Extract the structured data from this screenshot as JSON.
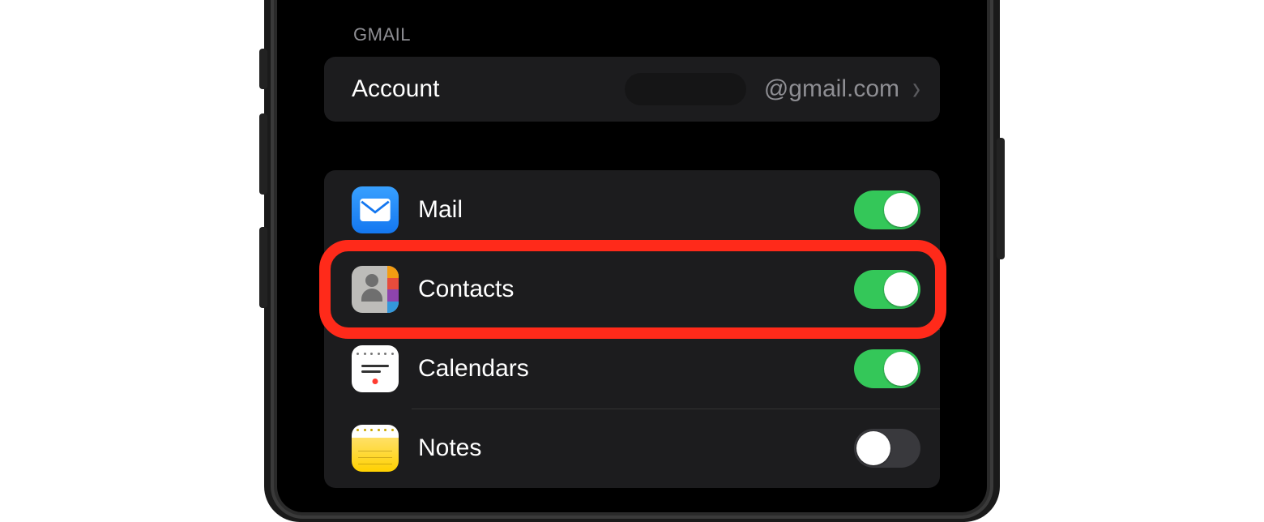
{
  "section_header": "GMAIL",
  "account_row": {
    "label": "Account",
    "value": "@gmail.com"
  },
  "services": [
    {
      "key": "mail",
      "label": "Mail",
      "icon": "mail-icon",
      "on": true
    },
    {
      "key": "contacts",
      "label": "Contacts",
      "icon": "contacts-icon",
      "on": true,
      "highlighted": true
    },
    {
      "key": "calendars",
      "label": "Calendars",
      "icon": "calendar-icon",
      "on": true
    },
    {
      "key": "notes",
      "label": "Notes",
      "icon": "notes-icon",
      "on": false
    }
  ],
  "highlight_color": "#ff2a1a"
}
